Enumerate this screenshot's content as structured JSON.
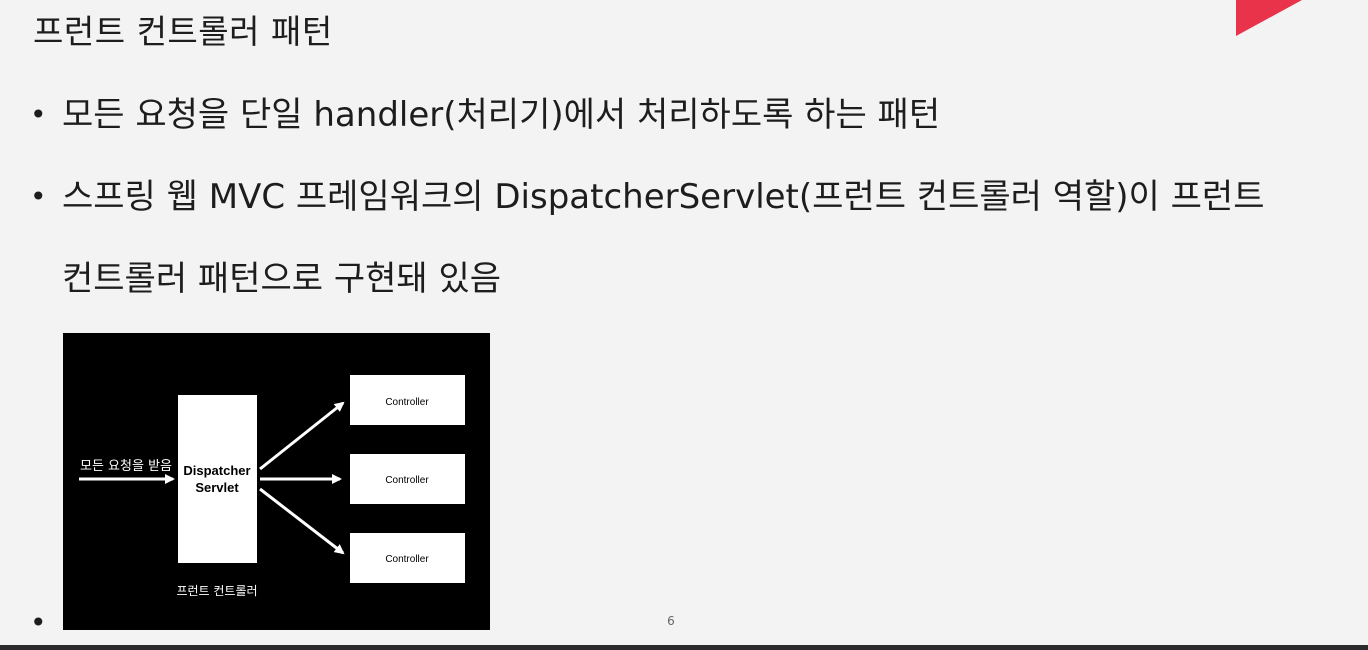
{
  "slide": {
    "title": "프런트 컨트롤러 패턴",
    "page_number": "6",
    "accent_color": "#e8334a"
  },
  "bullets": [
    {
      "marker": "•",
      "text": "모든 요청을 단일 handler(처리기)에서 처리하도록 하는 패턴"
    },
    {
      "marker": "•",
      "text": "스프링 웹 MVC 프레임워크의 DispatcherServlet(프런트 컨트롤러 역할)이 프런트",
      "continuation": "컨트롤러 패턴으로 구현돼 있음"
    },
    {
      "marker": "•",
      "text": ""
    }
  ],
  "diagram": {
    "input_label": "모든 요청을 받음",
    "dispatcher_line1": "Dispatcher",
    "dispatcher_line2": "Servlet",
    "caption": "프런트 컨트롤러",
    "controllers": [
      "Controller",
      "Controller",
      "Controller"
    ],
    "background": "#000000",
    "box_color": "#ffffff"
  }
}
